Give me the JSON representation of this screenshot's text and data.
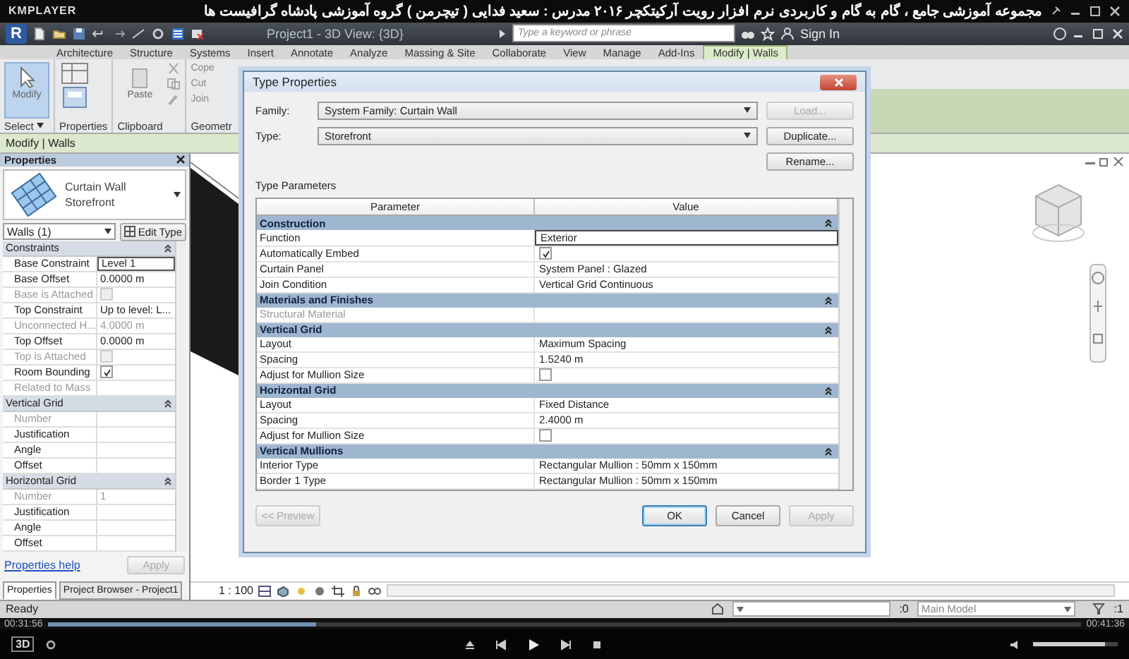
{
  "player": {
    "brand": "KMPLAYER",
    "title": "مجموعه آموزشی جامع ، گام به گام و کاربردی نرم افزار رویت آرکیتکچر ۲۰۱۶   مدرس : سعید فدایی ( تیچرمن ) گروه آموزشی پادشاه گرافیست ها",
    "elapsed": "00:31:56",
    "total": "00:41:36",
    "progress": {
      "level": 0.26
    },
    "volume": {
      "level": 0.85
    },
    "badge": "3D"
  },
  "app": {
    "logo": "R",
    "title": "Project1 - 3D View: {3D}",
    "search": {
      "placeholder": "Type a keyword or phrase"
    },
    "sign_in": "Sign In"
  },
  "ribbon_tabs": [
    {
      "label": "Architecture",
      "selected": false
    },
    {
      "label": "Structure",
      "selected": false
    },
    {
      "label": "Systems",
      "selected": false
    },
    {
      "label": "Insert",
      "selected": false
    },
    {
      "label": "Annotate",
      "selected": false
    },
    {
      "label": "Analyze",
      "selected": false
    },
    {
      "label": "Massing & Site",
      "selected": false
    },
    {
      "label": "Collaborate",
      "selected": false
    },
    {
      "label": "View",
      "selected": false
    },
    {
      "label": "Manage",
      "selected": false
    },
    {
      "label": "Add-Ins",
      "selected": false
    },
    {
      "label": "Modify | Walls",
      "selected": true
    }
  ],
  "ribbon": {
    "modify": {
      "label": "Modify",
      "selected": true
    },
    "paste": "Paste",
    "small_tools": [
      "Cope",
      "Cut",
      "Join"
    ],
    "panels": [
      "Select",
      "Properties",
      "Clipboard",
      "Geometr"
    ]
  },
  "options_bar": "Modify | Walls",
  "properties": {
    "title": "Properties",
    "type_name": "Curtain Wall",
    "type_sub": "Storefront",
    "selector": "Walls (1)",
    "edit_type": "Edit Type",
    "rows": [
      {
        "kind": "group",
        "label": "Constraints"
      },
      {
        "kind": "text",
        "label": "Base Constraint",
        "value": "Level 1",
        "disabled": false,
        "active": true
      },
      {
        "kind": "text",
        "label": "Base Offset",
        "value": "0.0000 m",
        "disabled": false,
        "active": false
      },
      {
        "kind": "check",
        "label": "Base is Attached",
        "checked": false,
        "disabled": true
      },
      {
        "kind": "text",
        "label": "Top Constraint",
        "value": "Up to level: L...",
        "disabled": false,
        "active": false
      },
      {
        "kind": "text",
        "label": "Unconnected H...",
        "value": "4.0000 m",
        "disabled": true,
        "active": false
      },
      {
        "kind": "text",
        "label": "Top Offset",
        "value": "0.0000 m",
        "disabled": false,
        "active": false
      },
      {
        "kind": "check",
        "label": "Top is Attached",
        "checked": false,
        "disabled": true
      },
      {
        "kind": "check",
        "label": "Room Bounding",
        "checked": true,
        "disabled": false
      },
      {
        "kind": "text",
        "label": "Related to Mass",
        "disabled": true,
        "active": false
      },
      {
        "kind": "group",
        "label": "Vertical Grid"
      },
      {
        "kind": "text",
        "label": "Number",
        "disabled": true,
        "active": false
      },
      {
        "kind": "text",
        "label": "Justification",
        "disabled": false,
        "active": false
      },
      {
        "kind": "text",
        "label": "Angle",
        "disabled": false,
        "active": false
      },
      {
        "kind": "text",
        "label": "Offset",
        "disabled": false,
        "active": false
      },
      {
        "kind": "group",
        "label": "Horizontal Grid"
      },
      {
        "kind": "text",
        "label": "Number",
        "value": "1",
        "disabled": true,
        "active": false
      },
      {
        "kind": "text",
        "label": "Justification",
        "disabled": false,
        "active": false
      },
      {
        "kind": "text",
        "label": "Angle",
        "disabled": false,
        "active": false
      },
      {
        "kind": "text",
        "label": "Offset",
        "disabled": false,
        "active": false
      }
    ],
    "help": "Properties help",
    "apply": "Apply"
  },
  "browser_tabs": [
    {
      "label": "Properties",
      "selected": true
    },
    {
      "label": "Project Browser - Project1",
      "selected": false
    }
  ],
  "dialog": {
    "title": "Type Properties",
    "family_label": "Family:",
    "family": "System Family: Curtain Wall",
    "type_label": "Type:",
    "type": "Storefront",
    "side_buttons": [
      {
        "label": "Load...",
        "disabled": true
      },
      {
        "label": "Duplicate...",
        "disabled": false
      },
      {
        "label": "Rename...",
        "disabled": false
      }
    ],
    "section": "Type Parameters",
    "columns": [
      "Parameter",
      "Value"
    ],
    "rows": [
      {
        "kind": "group",
        "label": "Construction"
      },
      {
        "kind": "text",
        "label": "Function",
        "value": "Exterior",
        "disabled": false,
        "active": true
      },
      {
        "kind": "check",
        "label": "Automatically Embed",
        "checked": true,
        "disabled": false
      },
      {
        "kind": "text",
        "label": "Curtain Panel",
        "value": "System Panel : Glazed",
        "disabled": false,
        "active": false
      },
      {
        "kind": "text",
        "label": "Join Condition",
        "value": "Vertical Grid Continuous",
        "disabled": false,
        "active": false
      },
      {
        "kind": "group",
        "label": "Materials and Finishes"
      },
      {
        "kind": "text",
        "label": "Structural Material",
        "disabled": true,
        "active": false
      },
      {
        "kind": "group",
        "label": "Vertical Grid"
      },
      {
        "kind": "text",
        "label": "Layout",
        "value": "Maximum Spacing",
        "disabled": false,
        "active": false
      },
      {
        "kind": "text",
        "label": "Spacing",
        "value": "1.5240 m",
        "disabled": false,
        "active": false
      },
      {
        "kind": "check",
        "label": "Adjust for Mullion Size",
        "checked": false,
        "disabled": false
      },
      {
        "kind": "group",
        "label": "Horizontal Grid"
      },
      {
        "kind": "text",
        "label": "Layout",
        "value": "Fixed Distance",
        "disabled": false,
        "active": false
      },
      {
        "kind": "text",
        "label": "Spacing",
        "value": "2.4000 m",
        "disabled": false,
        "active": false
      },
      {
        "kind": "check",
        "label": "Adjust for Mullion Size",
        "checked": false,
        "disabled": false
      },
      {
        "kind": "group",
        "label": "Vertical Mullions"
      },
      {
        "kind": "text",
        "label": "Interior Type",
        "value": "Rectangular Mullion : 50mm x 150mm",
        "disabled": false,
        "active": false
      },
      {
        "kind": "text",
        "label": "Border 1 Type",
        "value": "Rectangular Mullion : 50mm x 150mm",
        "disabled": false,
        "active": false
      }
    ],
    "footer_buttons": [
      {
        "label": "<< Preview",
        "disabled": true,
        "focused": false
      },
      {
        "label": "OK",
        "disabled": false,
        "focused": true
      },
      {
        "label": "Cancel",
        "disabled": false,
        "focused": false
      },
      {
        "label": "Apply",
        "disabled": true,
        "focused": false
      }
    ]
  },
  "view_bar": {
    "scale": "1 : 100"
  },
  "status_bar": {
    "text": "Ready",
    "pick_count": ":0",
    "model": "Main Model",
    "filter_count": ":1"
  }
}
